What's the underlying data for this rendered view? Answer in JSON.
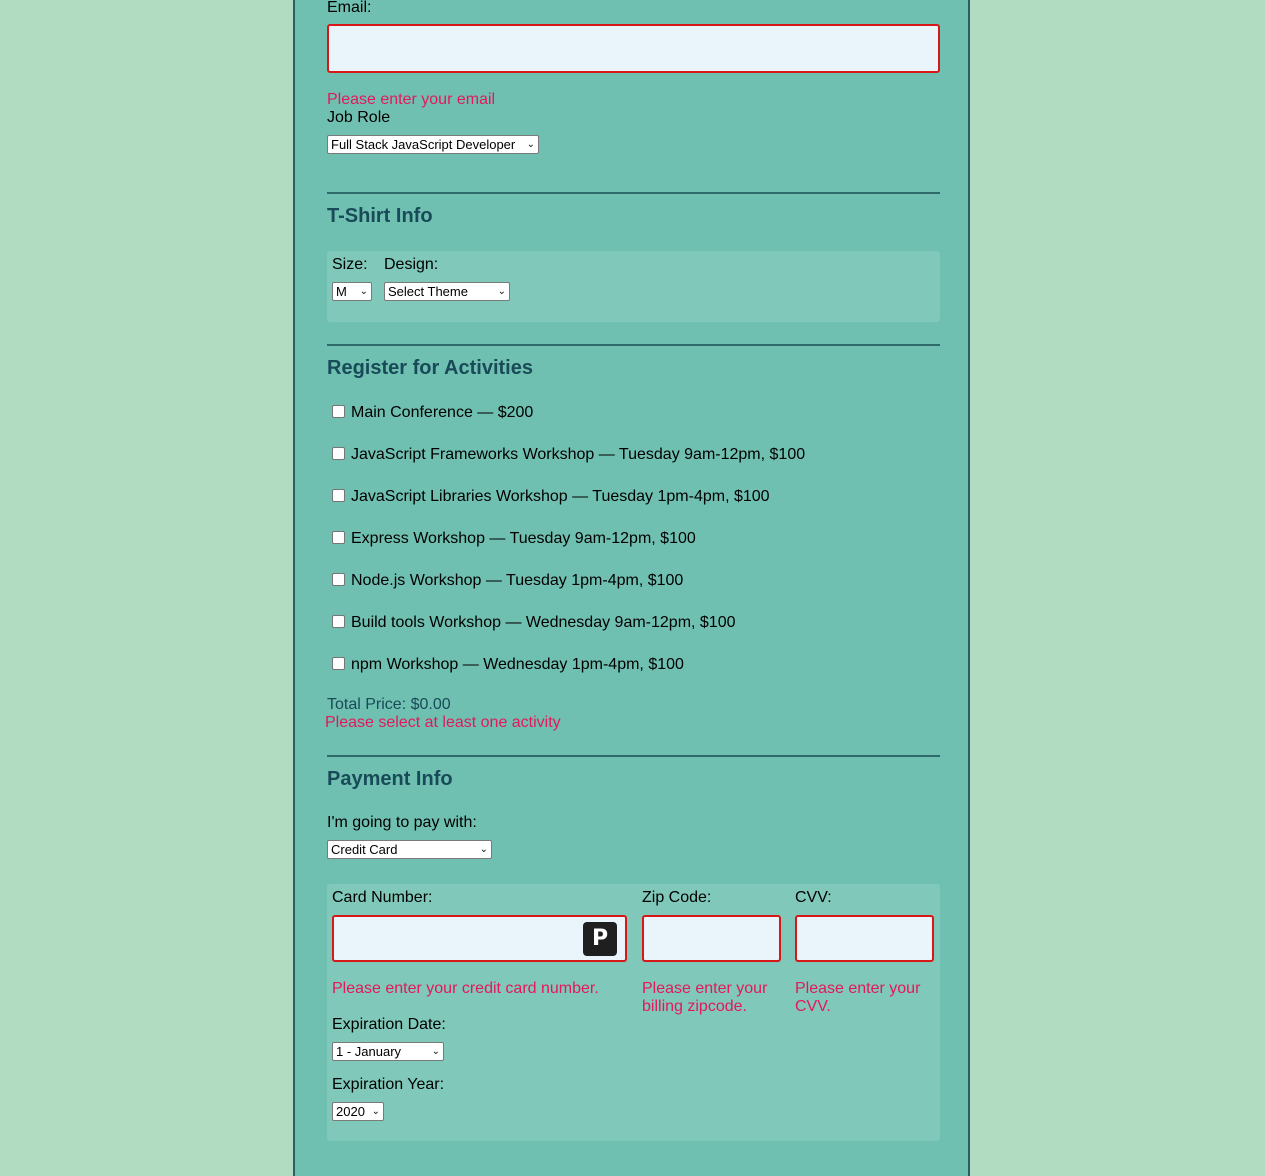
{
  "basic_info": {
    "email_label": "Email:",
    "email_value": "",
    "email_error": "Please enter your email",
    "job_role_label": "Job Role",
    "job_role_selected": "Full Stack JavaScript Developer"
  },
  "tshirt": {
    "heading": "T-Shirt Info",
    "size_label": "Size:",
    "size_selected": "M",
    "design_label": "Design:",
    "design_selected": "Select Theme"
  },
  "activities": {
    "heading": "Register for Activities",
    "items": [
      {
        "label": "Main Conference — $200",
        "checked": false
      },
      {
        "label": "JavaScript Frameworks Workshop — Tuesday 9am-12pm, $100",
        "checked": false
      },
      {
        "label": "JavaScript Libraries Workshop — Tuesday 1pm-4pm, $100",
        "checked": false
      },
      {
        "label": "Express Workshop — Tuesday 9am-12pm, $100",
        "checked": false
      },
      {
        "label": "Node.js Workshop — Tuesday 1pm-4pm, $100",
        "checked": false
      },
      {
        "label": "Build tools Workshop — Wednesday 9am-12pm, $100",
        "checked": false
      },
      {
        "label": "npm Workshop — Wednesday 1pm-4pm, $100",
        "checked": false
      }
    ],
    "total": "Total Price: $0.00",
    "error": "Please select at least one activity"
  },
  "payment": {
    "heading": "Payment Info",
    "pay_with_label": "I'm going to pay with:",
    "pay_with_selected": "Credit Card",
    "card_number_label": "Card Number:",
    "card_number_value": "",
    "card_number_error": "Please enter your credit card number.",
    "password_manager_icon_glyph": "P",
    "zip_label": "Zip Code:",
    "zip_value": "",
    "zip_error": "Please enter your billing zipcode.",
    "cvv_label": "CVV:",
    "cvv_value": "",
    "cvv_error": "Please enter your CVV.",
    "exp_date_label": "Expiration Date:",
    "exp_date_selected": "1 - January",
    "exp_year_label": "Expiration Year:",
    "exp_year_selected": "2020"
  },
  "colors": {
    "page_background": "#b2dcc2",
    "panel_background": "#70c0b2",
    "heading": "#184a58",
    "error": "#e3185c",
    "invalid_border": "#d81818",
    "input_background": "#e9f4fb"
  }
}
